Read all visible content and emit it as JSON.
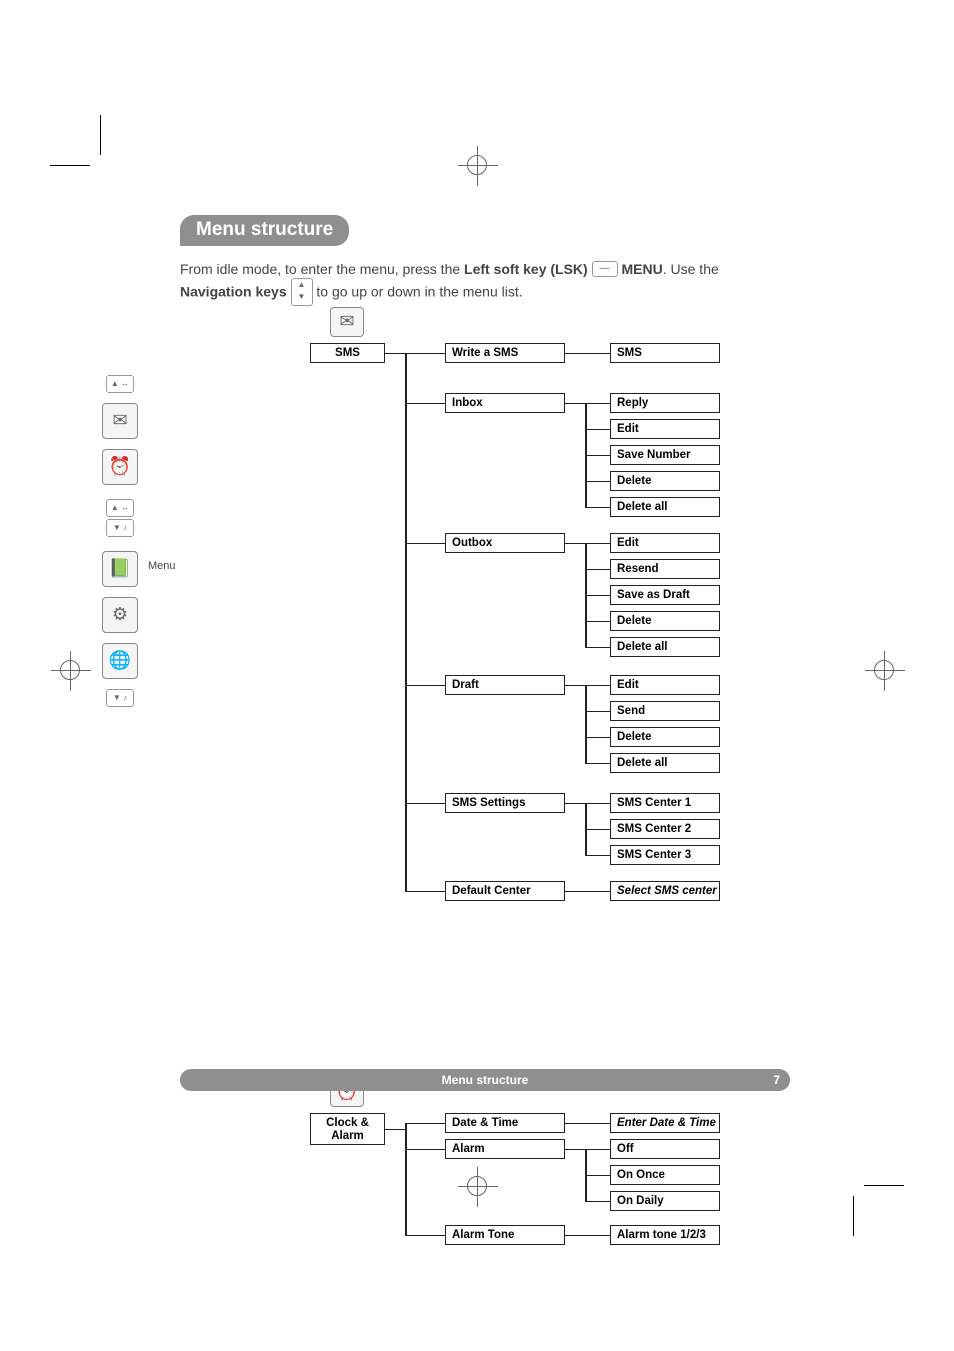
{
  "title": "Menu structure",
  "intro_parts": {
    "p1": "From idle mode, to enter the menu, press the ",
    "lsk": "Left soft key (LSK)",
    "menu": "MENU",
    "p2": ". Use the ",
    "nav": "Navigation keys",
    "p3": " to go up or down in the menu list."
  },
  "footer": {
    "label": "Menu structure",
    "page": "7"
  },
  "labels": {
    "menu_side": "Menu"
  },
  "sms": {
    "root": "SMS",
    "level2": {
      "write": "Write a SMS",
      "inbox": "Inbox",
      "outbox": "Outbox",
      "draft": "Draft",
      "settings": "SMS Settings",
      "default_center": "Default Center"
    },
    "write_children": {
      "sms": "SMS"
    },
    "inbox_children": {
      "reply": "Reply",
      "edit": "Edit",
      "save_number": "Save Number",
      "delete": "Delete",
      "delete_all": "Delete all"
    },
    "outbox_children": {
      "edit": "Edit",
      "resend": "Resend",
      "save_draft": "Save as Draft",
      "delete": "Delete",
      "delete_all": "Delete all"
    },
    "draft_children": {
      "edit": "Edit",
      "send": "Send",
      "delete": "Delete",
      "delete_all": "Delete all"
    },
    "settings_children": {
      "c1": "SMS Center 1",
      "c2": "SMS Center 2",
      "c3": "SMS Center 3"
    },
    "default_center_children": {
      "select": "Select SMS center"
    }
  },
  "clock": {
    "root": "Clock & Alarm",
    "level2": {
      "datetime": "Date & Time",
      "alarm": "Alarm",
      "alarm_tone": "Alarm Tone"
    },
    "datetime_children": {
      "enter": "Enter Date & Time"
    },
    "alarm_children": {
      "off": "Off",
      "once": "On Once",
      "daily": "On Daily"
    },
    "tone_children": {
      "tones": "Alarm tone 1/2/3"
    }
  }
}
